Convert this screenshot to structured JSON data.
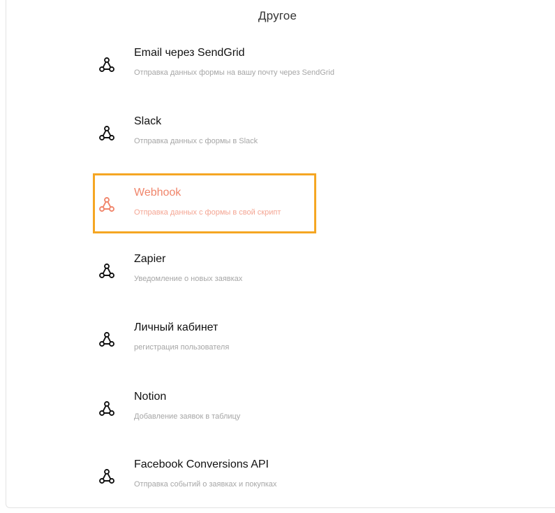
{
  "section": {
    "title": "Другое"
  },
  "integrations": [
    {
      "name": "Email через SendGrid",
      "description": "Отправка данных формы на вашу почту через SendGrid",
      "icon": "webhook-icon"
    },
    {
      "name": "Slack",
      "description": "Отправка данных с формы в Slack",
      "icon": "webhook-icon"
    },
    {
      "name": "Webhook",
      "description": "Отправка данных с формы в свой скрипт",
      "icon": "webhook-icon",
      "selected": true
    },
    {
      "name": "Zapier",
      "description": "Уведомление о новых заявках",
      "icon": "webhook-icon"
    },
    {
      "name": "Личный кабинет",
      "description": "регистрация пользователя",
      "icon": "webhook-icon"
    },
    {
      "name": "Notion",
      "description": "Добавление заявок в таблицу",
      "icon": "webhook-icon"
    },
    {
      "name": "Facebook Conversions API",
      "description": "Отправка событий о заявках и покупках",
      "icon": "webhook-icon"
    }
  ],
  "colors": {
    "highlight_border": "#f5a623",
    "selected_text": "#f0856b",
    "default_icon": "#111111"
  }
}
